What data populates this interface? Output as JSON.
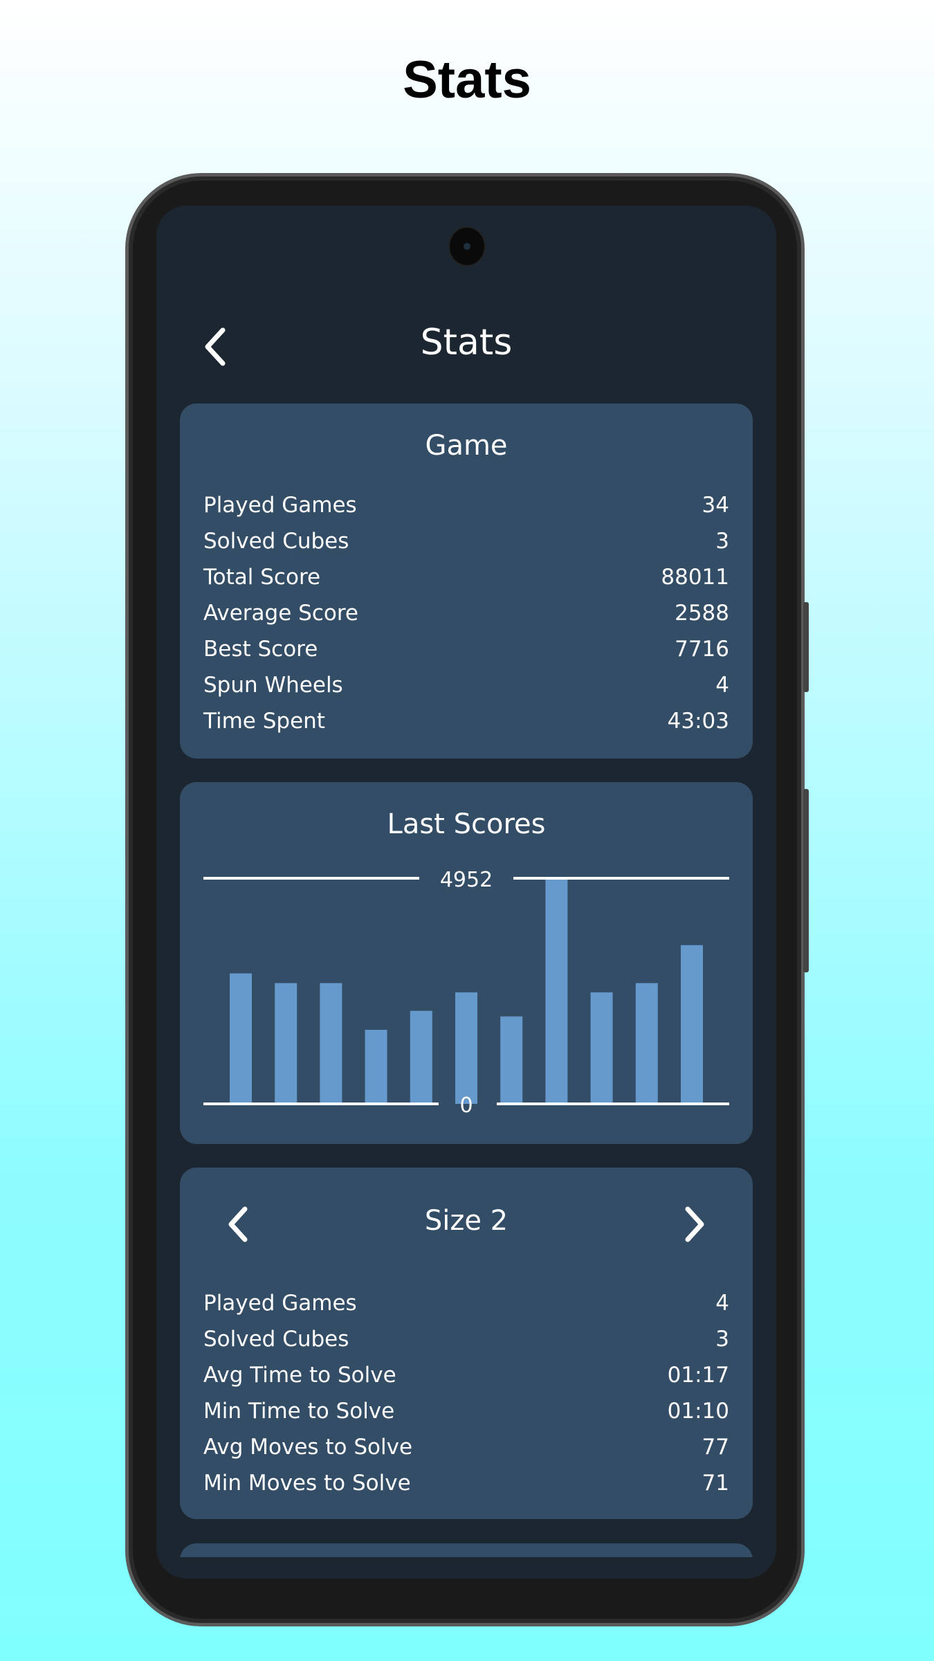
{
  "page_title": "Stats",
  "header": {
    "title": "Stats",
    "back_icon": "chevron-left-icon"
  },
  "game_card": {
    "title": "Game",
    "rows": [
      {
        "label": "Played Games",
        "value": "34"
      },
      {
        "label": "Solved Cubes",
        "value": "3"
      },
      {
        "label": "Total Score",
        "value": "88011"
      },
      {
        "label": "Average Score",
        "value": "2588"
      },
      {
        "label": "Best Score",
        "value": "7716"
      },
      {
        "label": "Spun Wheels",
        "value": "4"
      },
      {
        "label": "Time Spent",
        "value": "43:03"
      }
    ]
  },
  "last_scores_card": {
    "title": "Last Scores"
  },
  "chart_data": {
    "type": "bar",
    "values": [
      2864,
      2651,
      2651,
      1625,
      2042,
      2448,
      1920,
      4952,
      2448,
      2651,
      3484
    ],
    "max_label": "4952",
    "min_label": "0",
    "ylim": [
      0,
      4952
    ],
    "bar_color": "#6699cc",
    "grid": false
  },
  "size_card": {
    "title": "Size 2",
    "prev_icon": "chevron-left-icon",
    "next_icon": "chevron-right-icon",
    "rows": [
      {
        "label": "Played Games",
        "value": "4"
      },
      {
        "label": "Solved Cubes",
        "value": "3"
      },
      {
        "label": "Avg Time to Solve",
        "value": "01:17"
      },
      {
        "label": "Min Time to Solve",
        "value": "01:10"
      },
      {
        "label": "Avg Moves to Solve",
        "value": "77"
      },
      {
        "label": "Min Moves to Solve",
        "value": "71"
      }
    ]
  },
  "colors": {
    "screen_bg": "#1b2631",
    "card_bg": "#334d66",
    "bar": "#6699cc",
    "text": "#ffffff"
  }
}
